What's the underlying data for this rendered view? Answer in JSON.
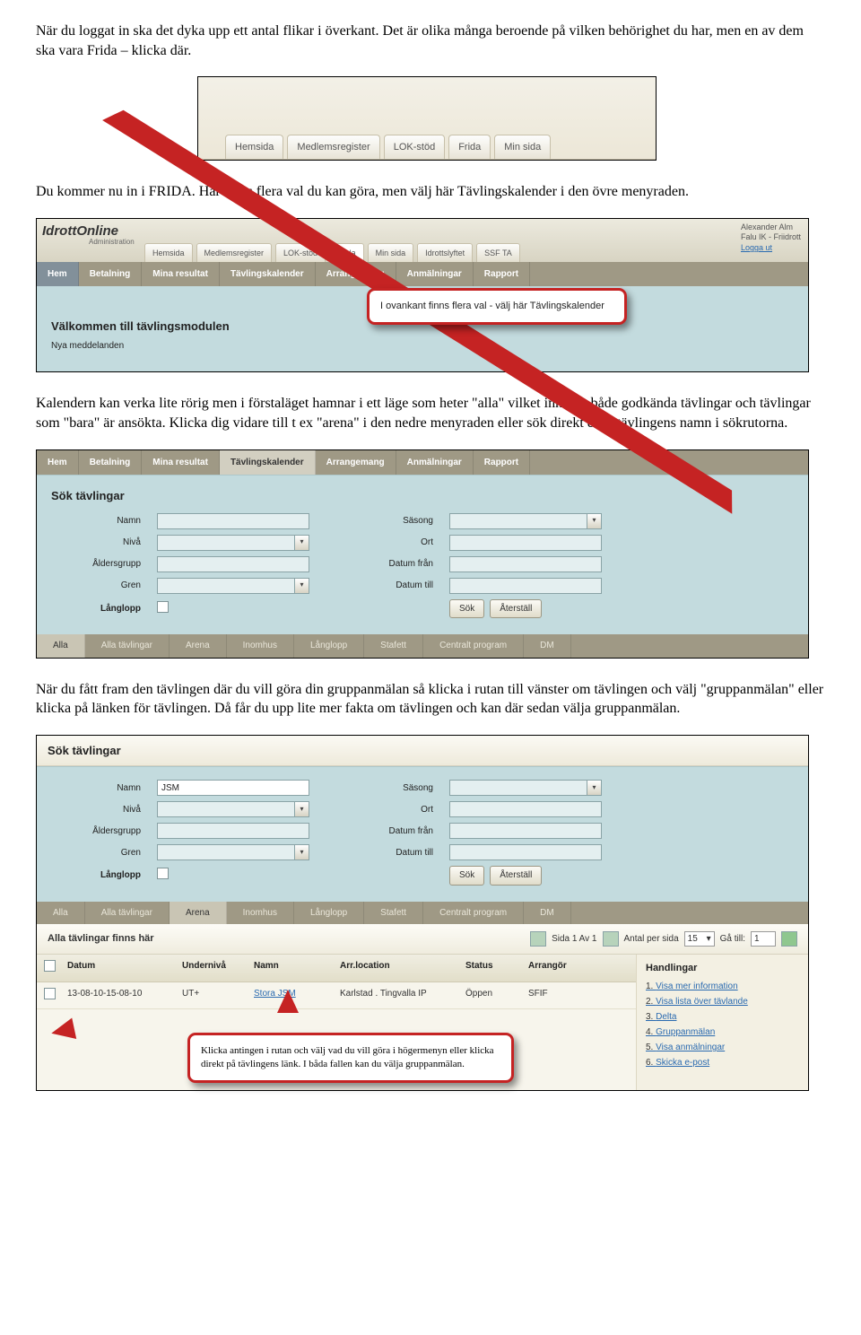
{
  "para1": "När du loggat in ska det dyka upp ett antal flikar i överkant. Det är olika många beroende på vilken behörighet du har, men en av dem ska vara Frida – klicka där.",
  "ss1": {
    "tabs": [
      "Hemsida",
      "Medlemsregister",
      "LOK-stöd",
      "Frida",
      "Min sida"
    ]
  },
  "para2": "Du kommer nu in i FRIDA. Här finns flera val du kan göra, men välj här Tävlingskalender i den övre menyraden.",
  "ss2": {
    "brand": "IdrottOnline",
    "brand_sub": "Administration",
    "top_tabs": [
      "Hemsida",
      "Medlemsregister",
      "LOK-stöd",
      "Frida",
      "Min sida",
      "Idrottslyftet",
      "SSF TA"
    ],
    "user": {
      "name": "Alexander Alm",
      "org": "Falu IK - Friidrott",
      "logout": "Logga ut"
    },
    "nav": [
      "Hem",
      "Betalning",
      "Mina resultat",
      "Tävlingskalender",
      "Arrangemang",
      "Anmälningar",
      "Rapport"
    ],
    "welcome_title": "Välkommen till tävlingsmodulen",
    "welcome_sub": "Nya meddelanden",
    "callout": "I ovankant finns flera val - välj här Tävlingskalender"
  },
  "para3": "Kalendern kan verka lite rörig men i förstaläget hamnar i ett läge som heter \"alla\" vilket innebär både godkända tävlingar och tävlingar som \"bara\" är ansökta. Klicka dig vidare till t ex \"arena\" i den nedre menyraden eller sök direkt efter tävlingens namn i sökrutorna.",
  "ss3": {
    "nav": [
      "Hem",
      "Betalning",
      "Mina resultat",
      "Tävlingskalender",
      "Arrangemang",
      "Anmälningar",
      "Rapport"
    ],
    "title": "Sök tävlingar",
    "labels": {
      "namn": "Namn",
      "niva": "Nivå",
      "grp": "Åldersgrupp",
      "gren": "Gren",
      "lang": "Långlopp",
      "sasong": "Säsong",
      "ort": "Ort",
      "dfrom": "Datum från",
      "dtill": "Datum till"
    },
    "btn_sok": "Sök",
    "btn_reset": "Återställ",
    "ftabs": [
      "Alla",
      "Alla tävlingar",
      "Arena",
      "Inomhus",
      "Långlopp",
      "Stafett",
      "Centralt program",
      "DM"
    ]
  },
  "para4": "När du fått fram den tävlingen där du vill göra din gruppanmälan så klicka i rutan till vänster om tävlingen och välj \"gruppanmälan\" eller klicka på länken för tävlingen. Då får du upp lite mer fakta om tävlingen och kan där sedan välja gruppanmälan.",
  "ss4": {
    "title": "Sök tävlingar",
    "labels": {
      "namn": "Namn",
      "niva": "Nivå",
      "grp": "Åldersgrupp",
      "gren": "Gren",
      "lang": "Långlopp",
      "sasong": "Säsong",
      "ort": "Ort",
      "dfrom": "Datum från",
      "dtill": "Datum till"
    },
    "namn_val": "JSM",
    "btn_sok": "Sök",
    "btn_reset": "Återställ",
    "ftabs": [
      "Alla",
      "Alla tävlingar",
      "Arena",
      "Inomhus",
      "Långlopp",
      "Stafett",
      "Centralt program",
      "DM"
    ],
    "leftlbl": "Alla tävlingar finns här",
    "sida": "Sida 1 Av 1",
    "antal": "Antal per sida",
    "antal_val": "15",
    "ga": "Gå till:",
    "ga_val": "1",
    "cols": {
      "chk": "",
      "datum": "Datum",
      "und": "Undernivå",
      "namn": "Namn",
      "loc": "Arr.location",
      "stat": "Status",
      "arr": "Arrangör"
    },
    "row": {
      "datum": "13-08-10-15-08-10",
      "und": "UT+",
      "namn": "Stora JSM",
      "loc": "Karlstad . Tingvalla IP",
      "stat": "Öppen",
      "arr": "SFIF"
    },
    "handl_title": "Handlingar",
    "handl": [
      "Visa mer information",
      "Visa lista över tävlande",
      "Delta",
      "Gruppanmälan",
      "Visa anmälningar",
      "Skicka e-post"
    ],
    "callout": "Klicka antingen i rutan och välj vad du vill göra i högermenyn eller klicka direkt på tävlingens länk. I båda fallen kan du välja gruppanmälan."
  }
}
